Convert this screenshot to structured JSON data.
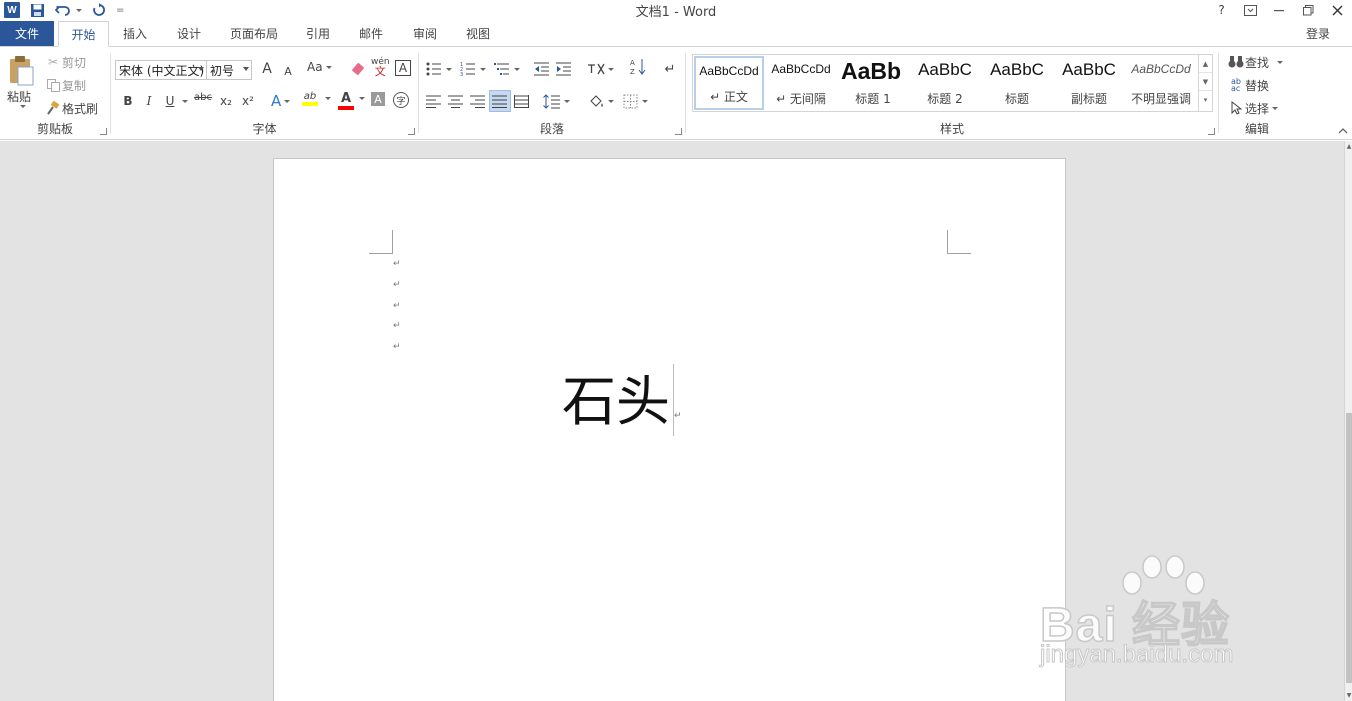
{
  "window": {
    "title": "文档1 - Word",
    "controls": [
      "?",
      "restore-ribbon",
      "minimize",
      "maximize",
      "close"
    ]
  },
  "qat": {
    "more_label": "="
  },
  "tabs": [
    "文件",
    "开始",
    "插入",
    "设计",
    "页面布局",
    "引用",
    "邮件",
    "审阅",
    "视图"
  ],
  "active_tab": "开始",
  "account": {
    "login_label": "登录"
  },
  "clipboard": {
    "paste_label": "粘贴",
    "cut_label": "剪切",
    "copy_label": "复制",
    "format_painter_label": "格式刷",
    "group_label": "剪贴板"
  },
  "font": {
    "font_name": "宋体 (中文正文)",
    "font_size": "初号",
    "grow_label": "A",
    "shrink_label": "A",
    "case_label": "Aa",
    "pinyin_label": "wén",
    "border_char_label": "A",
    "bold": "B",
    "italic": "I",
    "underline": "U",
    "strike": "abc",
    "subscript": "x₂",
    "superscript": "x²",
    "effects_label": "A",
    "highlight_label": "ab",
    "font_color_label": "A",
    "shading_label": "A",
    "enclose_label": "字",
    "group_label": "字体"
  },
  "paragraph": {
    "group_label": "段落",
    "sort_label": "A↓Z"
  },
  "styles": {
    "items": [
      {
        "preview": "AaBbCcDd",
        "name": "↵ 正文"
      },
      {
        "preview": "AaBbCcDd",
        "name": "↵ 无间隔"
      },
      {
        "preview": "AaBb",
        "name": "标题 1"
      },
      {
        "preview": "AaBbC",
        "name": "标题 2"
      },
      {
        "preview": "AaBbC",
        "name": "标题"
      },
      {
        "preview": "AaBbC",
        "name": "副标题"
      },
      {
        "preview": "AaBbCcDd",
        "name": "不明显强调"
      }
    ],
    "group_label": "样式"
  },
  "editing": {
    "find_label": "查找",
    "replace_label": "替换",
    "select_label": "选择",
    "group_label": "编辑"
  },
  "document": {
    "paragraph_mark": "↵",
    "main_text": "石头"
  },
  "watermark": {
    "main": "Bai  经验",
    "sub": "jingyan.baidu.com"
  },
  "colors": {
    "accent": "#2b579a",
    "highlight": "#ffff00",
    "font_color": "#ff0000"
  }
}
